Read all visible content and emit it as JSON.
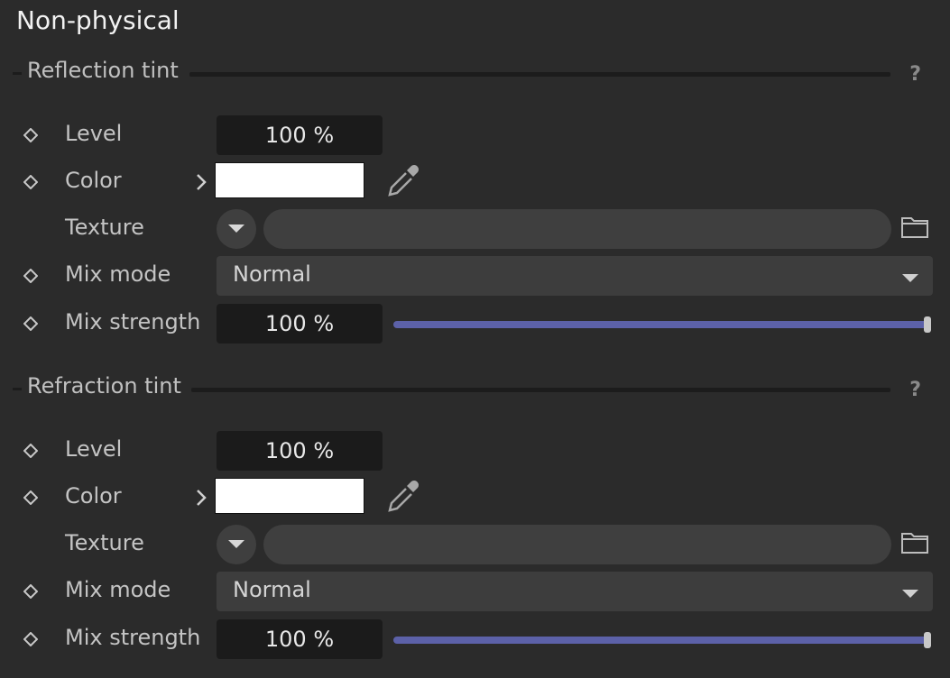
{
  "title": "Non-physical",
  "sections": [
    {
      "label": "Reflection tint",
      "help": "?",
      "level": {
        "label": "Level",
        "value": "100 %"
      },
      "color": {
        "label": "Color",
        "value": "#ffffff"
      },
      "texture": {
        "label": "Texture",
        "value": ""
      },
      "mix_mode": {
        "label": "Mix mode",
        "value": "Normal"
      },
      "mix_strength": {
        "label": "Mix strength",
        "value": "100 %",
        "fraction": 1.0
      }
    },
    {
      "label": "Refraction tint",
      "help": "?",
      "level": {
        "label": "Level",
        "value": "100 %"
      },
      "color": {
        "label": "Color",
        "value": "#ffffff"
      },
      "texture": {
        "label": "Texture",
        "value": ""
      },
      "mix_mode": {
        "label": "Mix mode",
        "value": "Normal"
      },
      "mix_strength": {
        "label": "Mix strength",
        "value": "100 %",
        "fraction": 1.0
      }
    }
  ],
  "colors": {
    "slider_fill": "#5c61a8",
    "field_bg": "#1b1b1b",
    "panel_bg": "#2b2b2b"
  },
  "icons": [
    "keyframe-diamond-icon",
    "chevron-right-icon",
    "eyedropper-icon",
    "dropdown-arrow-icon",
    "folder-icon",
    "help-icon"
  ]
}
